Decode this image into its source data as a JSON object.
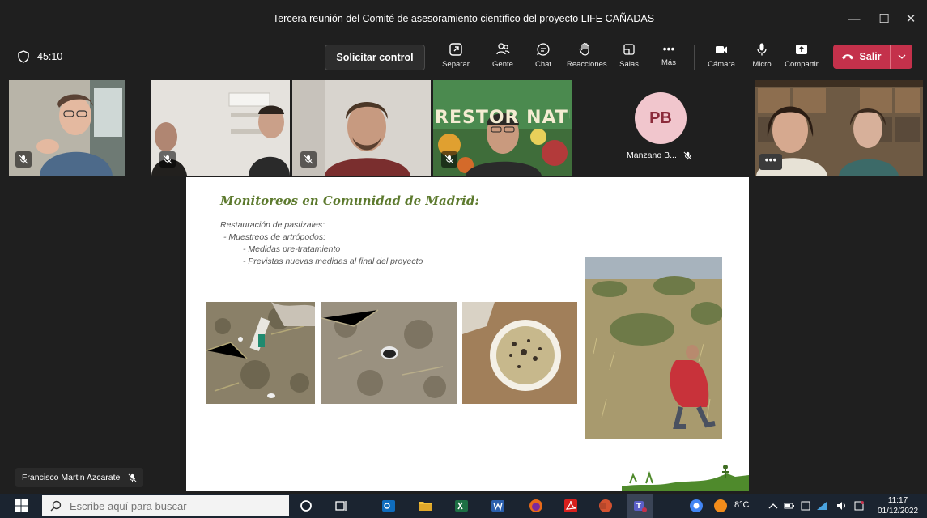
{
  "window": {
    "title": "Tercera reunión del Comité de asesoramiento científico del proyecto LIFE CAÑADAS",
    "minimize": "—",
    "maximize": "☐",
    "close": "✕"
  },
  "toolbar": {
    "timer": "45:10",
    "request_control": "Solicitar control",
    "tools": [
      {
        "label": "Separar",
        "icon": "pop-out-icon"
      },
      {
        "label": "Gente",
        "icon": "people-icon"
      },
      {
        "label": "Chat",
        "icon": "chat-icon"
      },
      {
        "label": "Reacciones",
        "icon": "raise-hand-icon"
      },
      {
        "label": "Salas",
        "icon": "rooms-icon"
      },
      {
        "label": "Más",
        "icon": "more-icon"
      },
      {
        "label": "Cámara",
        "icon": "camera-icon"
      },
      {
        "label": "Micro",
        "icon": "mic-icon"
      },
      {
        "label": "Compartir",
        "icon": "share-icon"
      }
    ],
    "more_glyph": "•••",
    "leave": "Salir"
  },
  "participants": {
    "avatar_initials": "PB",
    "avatar_name": "Manzano B...",
    "more_dots": "•••",
    "tile5_banner": "RESTOR NATURE"
  },
  "slide": {
    "title": "Monitoreos en Comunidad de Madrid:",
    "lines": [
      "Restauración de pastizales:",
      "-   Muestreos de artrópodos:",
      "-   Medidas pre-tratamiento",
      "-   Previstas nuevas medidas al final del proyecto"
    ]
  },
  "presenter": {
    "name": "Francisco Martin Azcarate"
  },
  "taskbar": {
    "search_placeholder": "Escribe aquí para buscar",
    "temperature": "8°C",
    "time": "11:17",
    "date": "01/12/2022"
  },
  "colors": {
    "leave_red": "#c4314b",
    "slide_title_green": "#5d7a2e",
    "avatar_bg": "#f1c6cd"
  }
}
